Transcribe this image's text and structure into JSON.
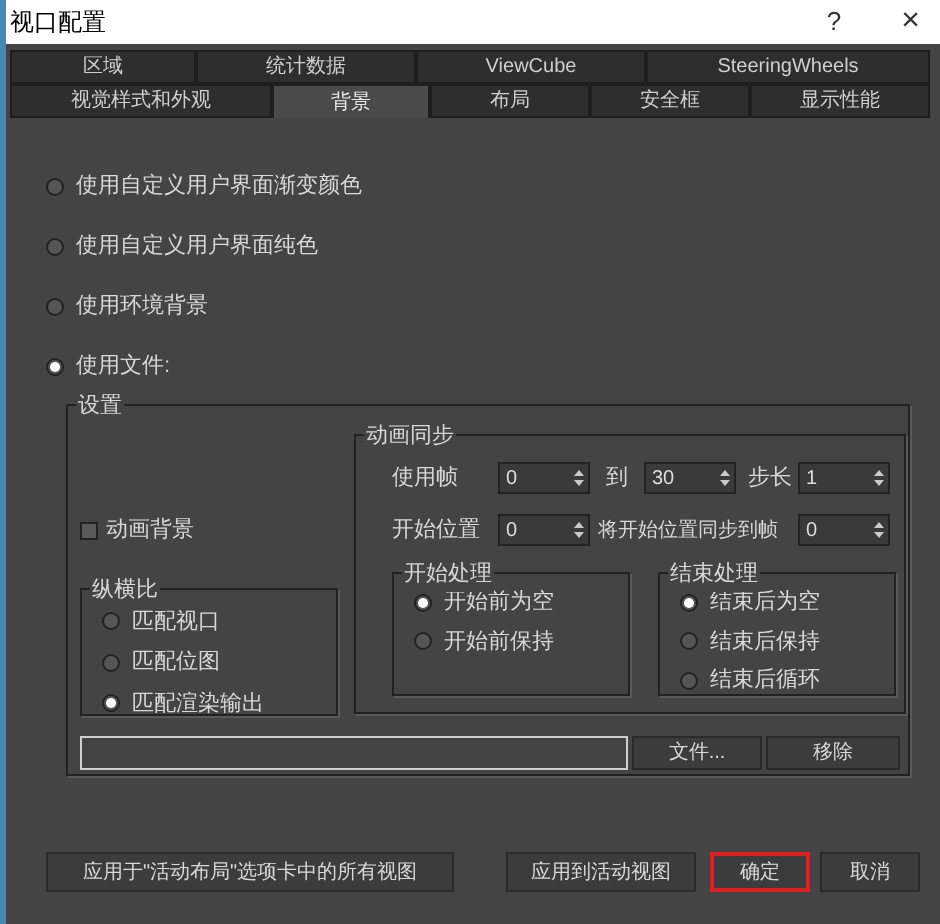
{
  "window": {
    "title": "视口配置",
    "help": "?",
    "close": "×"
  },
  "tab_rows": [
    {
      "tabs": [
        {
          "label": "区域",
          "selected": false
        },
        {
          "label": "统计数据",
          "selected": false
        },
        {
          "label": "ViewCube",
          "selected": false
        },
        {
          "label": "SteeringWheels",
          "selected": false
        }
      ]
    },
    {
      "tabs": [
        {
          "label": "视觉样式和外观",
          "selected": false
        },
        {
          "label": "背景",
          "selected": true
        },
        {
          "label": "布局",
          "selected": false
        },
        {
          "label": "安全框",
          "selected": false
        },
        {
          "label": "显示性能",
          "selected": false
        }
      ]
    }
  ],
  "background_options": [
    {
      "label": "使用自定义用户界面渐变颜色",
      "selected": false
    },
    {
      "label": "使用自定义用户界面纯色",
      "selected": false
    },
    {
      "label": "使用环境背景",
      "selected": false
    },
    {
      "label": "使用文件:",
      "selected": true
    }
  ],
  "settings": {
    "title": "设置",
    "animate_background": {
      "label": "动画背景",
      "checked": false
    },
    "aspect_ratio": {
      "title": "纵横比",
      "options": [
        {
          "label": "匹配视口",
          "selected": false
        },
        {
          "label": "匹配位图",
          "selected": false
        },
        {
          "label": "匹配渲染输出",
          "selected": true
        }
      ]
    },
    "animation_sync": {
      "title": "动画同步",
      "use_frames": {
        "label": "使用帧",
        "from": "0",
        "to_label": "到",
        "to": "30",
        "step_label": "步长",
        "step": "1"
      },
      "start_at": {
        "label": "开始位置",
        "value": "0",
        "sync_label": "将开始位置同步到帧",
        "sync_value": "0"
      },
      "start_processing": {
        "title": "开始处理",
        "options": [
          {
            "label": "开始前为空",
            "selected": true
          },
          {
            "label": "开始前保持",
            "selected": false
          }
        ]
      },
      "end_processing": {
        "title": "结束处理",
        "options": [
          {
            "label": "结束后为空",
            "selected": true
          },
          {
            "label": "结束后保持",
            "selected": false
          },
          {
            "label": "结束后循环",
            "selected": false
          }
        ]
      }
    },
    "file_button": "文件...",
    "remove_button": "移除"
  },
  "buttons": [
    {
      "label": "应用于\"活动布局\"选项卡中的所有视图",
      "highlighted": false
    },
    {
      "label": "应用到活动视图",
      "highlighted": false
    },
    {
      "label": "确定",
      "highlighted": true
    },
    {
      "label": "取消",
      "highlighted": false
    }
  ]
}
